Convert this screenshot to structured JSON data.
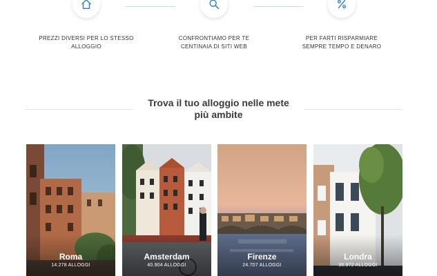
{
  "features": [
    {
      "icon": "home-icon",
      "line1": "PREZZI DIVERSI PER LO STESSO",
      "line2": "ALLOGGIO"
    },
    {
      "icon": "search-icon",
      "line1": "CONFRONTIAMO PER TE",
      "line2": "CENTINAIA DI SITI WEB"
    },
    {
      "icon": "percent-icon",
      "line1": "PER FARTI RISPARMIARE",
      "line2": "SEMPRE TEMPO E DENARO"
    }
  ],
  "section": {
    "title_line1": "Trova il tuo alloggio nelle mete",
    "title_line2": "più ambite"
  },
  "destinations": [
    {
      "city": "Roma",
      "count": "14.278 ALLOGGI"
    },
    {
      "city": "Amsterdam",
      "count": "40.904 ALLOGGI"
    },
    {
      "city": "Firenze",
      "count": "24.707 ALLOGGI"
    },
    {
      "city": "Londra",
      "count": "36.972 ALLOGGI"
    }
  ],
  "colors": {
    "icon_accent": "#2f7fc1",
    "divider": "#c9dbe8"
  }
}
